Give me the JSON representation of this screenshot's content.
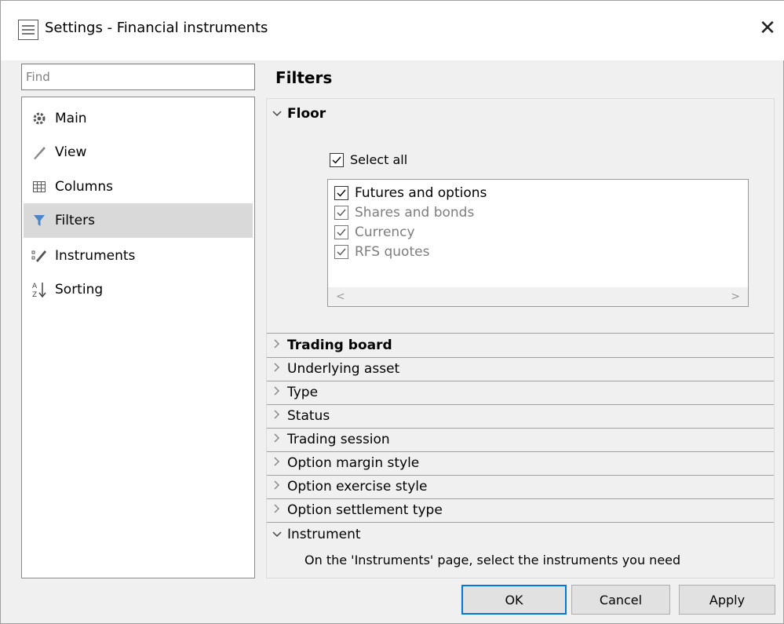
{
  "window": {
    "title": "Settings - Financial instruments",
    "close_label": "✕",
    "icon": "settings-window-icon"
  },
  "sidebar": {
    "search_placeholder": "Find",
    "items": [
      {
        "label": "Main",
        "icon": "gear-icon"
      },
      {
        "label": "View",
        "icon": "brush-icon"
      },
      {
        "label": "Columns",
        "icon": "table-icon"
      },
      {
        "label": "Filters",
        "icon": "funnel-icon",
        "selected": true
      },
      {
        "label": "Instruments",
        "icon": "pencil-grid-icon"
      },
      {
        "label": "Sorting",
        "icon": "sort-az-icon"
      }
    ]
  },
  "panel": {
    "title": "Filters",
    "floor": {
      "label": "Floor",
      "select_all": "Select all",
      "options": [
        {
          "label": "Futures and options",
          "checked": true,
          "enabled": true
        },
        {
          "label": "Shares and bonds",
          "checked": true,
          "enabled": false
        },
        {
          "label": "Currency",
          "checked": true,
          "enabled": false
        },
        {
          "label": "RFS quotes",
          "checked": true,
          "enabled": false
        }
      ],
      "scroll_left": "<",
      "scroll_right": ">"
    },
    "sections": [
      {
        "label": "Trading board",
        "bold": true
      },
      {
        "label": "Underlying asset"
      },
      {
        "label": "Type"
      },
      {
        "label": "Status"
      },
      {
        "label": "Trading session"
      },
      {
        "label": "Option margin style"
      },
      {
        "label": "Option exercise style"
      },
      {
        "label": "Option settlement type"
      }
    ],
    "instrument": {
      "label": "Instrument",
      "hint": "On the 'Instruments' page, select the instruments you need"
    }
  },
  "buttons": {
    "ok": "OK",
    "cancel": "Cancel",
    "apply": "Apply"
  },
  "colors": {
    "selected_item_bg": "#d9d9d9",
    "primary_button_border": "#0078d7",
    "disabled_text": "#7d7d7d"
  }
}
